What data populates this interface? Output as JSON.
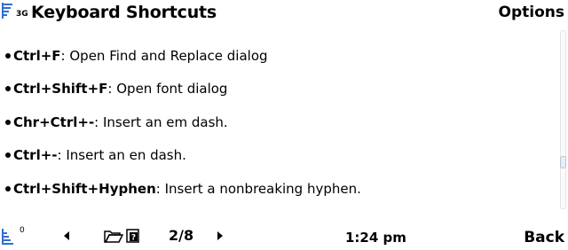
{
  "status": {
    "network": "3G"
  },
  "header": {
    "title": "Keyboard Shortcuts",
    "options_label": "Options"
  },
  "shortcuts": [
    {
      "keys": "Ctrl+F",
      "description": ": Open Find and Replace dialog"
    },
    {
      "keys": "Ctrl+Shift+F",
      "description": ": Open font dialog"
    },
    {
      "keys": "Chr+Ctrl+-",
      "description": ": Insert an em dash."
    },
    {
      "keys": "Ctrl+-",
      "description": ": Insert an en dash."
    },
    {
      "keys": "Ctrl+Shift+Hyphen",
      "description": ": Insert a nonbreaking hyphen."
    }
  ],
  "footer": {
    "battery_indicator": "0",
    "page_indicator": "2/8",
    "time": "1:24 pm",
    "back_label": "Back"
  },
  "icons": [
    "signal-strength-icon",
    "battery-icon",
    "prev-page-icon",
    "folder-open-icon",
    "help-document-icon",
    "next-page-icon"
  ],
  "colors": {
    "signal_blue": "#2f6fd1",
    "background": "#ffffff"
  }
}
